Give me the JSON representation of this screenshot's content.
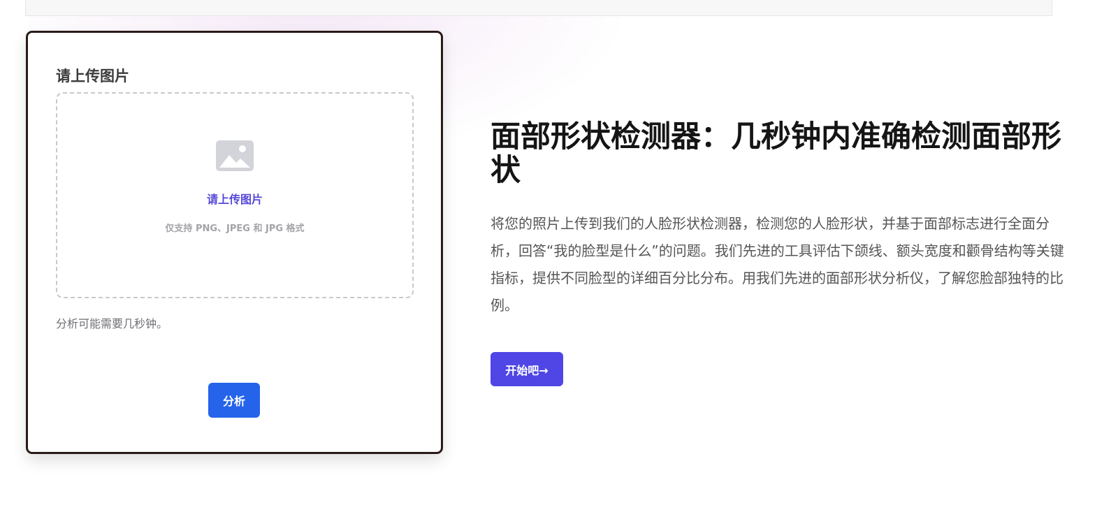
{
  "upload": {
    "title": "请上传图片",
    "dropzone_title": "请上传图片",
    "dropzone_hint": "仅支持 PNG、JPEG 和 JPG 格式",
    "dropzone_icon": "image-placeholder-icon",
    "note": "分析可能需要几秒钟。",
    "analyze_label": "分析"
  },
  "hero": {
    "title": "面部形状检测器：几秒钟内准确检测面部形状",
    "description": "将您的照片上传到我们的人脸形状检测器，检测您的人脸形状，并基于面部标志进行全面分析，回答“我的脸型是什么”的问题。我们先进的工具评估下颌线、额头宽度和颧骨结构等关键指标，提供不同脸型的详细百分比分布。用我们先进的面部形状分析仪，了解您脸部独特的比例。",
    "cta_label": "开始吧→"
  },
  "colors": {
    "analyze_button": "#2563eb",
    "cta_button": "#4f46e5",
    "dropzone_title": "#5548d6",
    "card_border": "#2a1a17"
  }
}
